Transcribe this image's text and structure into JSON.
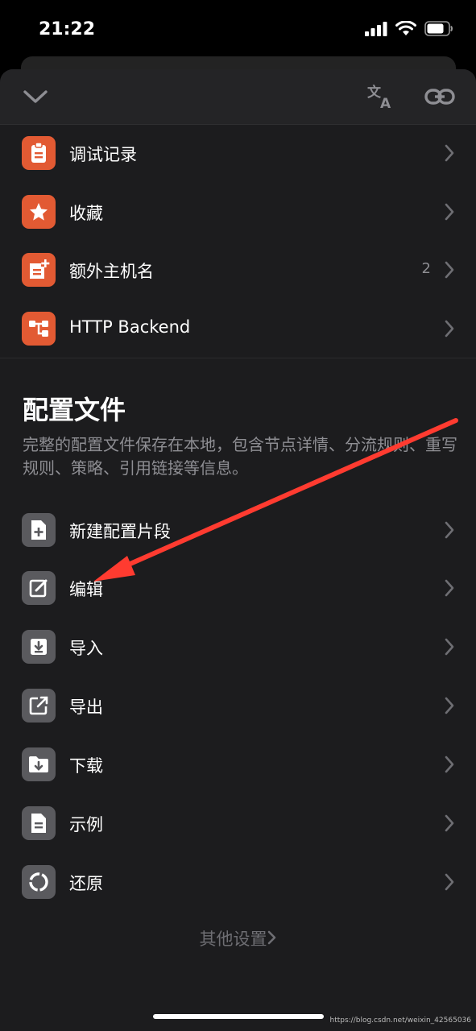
{
  "status_bar": {
    "time": "21:22"
  },
  "header": {
    "collapse_icon": "chevron-down-icon",
    "translate_icon": "translate-icon",
    "link_icon": "link-icon"
  },
  "top_items": [
    {
      "label": "调试记录",
      "icon": "clipboard-icon",
      "count": ""
    },
    {
      "label": "收藏",
      "icon": "star-icon",
      "count": ""
    },
    {
      "label": "额外主机名",
      "icon": "add-note-icon",
      "count": "2"
    },
    {
      "label": "HTTP Backend",
      "icon": "flow-icon",
      "count": ""
    }
  ],
  "section": {
    "title": "配置文件",
    "description": "完整的配置文件保存在本地，包含节点详情、分流规则、重写规则、策略、引用链接等信息。"
  },
  "config_items": [
    {
      "label": "新建配置片段",
      "icon": "new-file-icon"
    },
    {
      "label": "编辑",
      "icon": "edit-icon"
    },
    {
      "label": "导入",
      "icon": "import-icon"
    },
    {
      "label": "导出",
      "icon": "export-icon"
    },
    {
      "label": "下载",
      "icon": "download-folder-icon"
    },
    {
      "label": "示例",
      "icon": "document-icon"
    },
    {
      "label": "还原",
      "icon": "restore-icon"
    }
  ],
  "footer": {
    "other_settings": "其他设置"
  },
  "watermark": "https://blog.csdn.net/weixin_42565036",
  "colors": {
    "accent_orange": "#e25a33",
    "icon_gray": "#5a5a5e",
    "annotation_red": "#ff3b30"
  }
}
